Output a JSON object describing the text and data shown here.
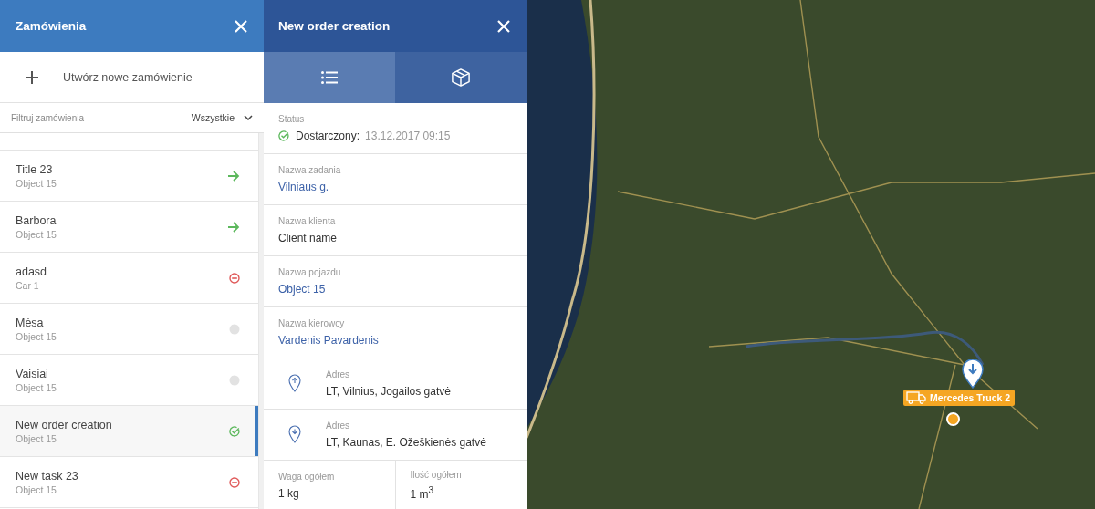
{
  "orders_panel": {
    "title": "Zamówienia",
    "create_label": "Utwórz nowe zamówienie",
    "filter": {
      "placeholder": "Filtruj zamówienia",
      "value": "Wszystkie"
    },
    "orders": [
      {
        "title": "Title 23",
        "subtitle": "Object 15",
        "kind": "arrow",
        "selected": false
      },
      {
        "title": "Barbora",
        "subtitle": "Object 15",
        "kind": "arrow",
        "selected": false
      },
      {
        "title": "adasd",
        "subtitle": "Car 1",
        "kind": "cancelled",
        "selected": false
      },
      {
        "title": "Mėsa",
        "subtitle": "Object 15",
        "kind": "idle",
        "selected": false
      },
      {
        "title": "Vaisiai",
        "subtitle": "Object 15",
        "kind": "idle",
        "selected": false
      },
      {
        "title": "New order creation",
        "subtitle": "Object 15",
        "kind": "done",
        "selected": true
      },
      {
        "title": "New task 23",
        "subtitle": "Object 15",
        "kind": "cancelled",
        "selected": false
      }
    ]
  },
  "detail_panel": {
    "title": "New order creation",
    "tabs": [
      {
        "kind": "list",
        "selected": true
      },
      {
        "kind": "box",
        "selected": false
      }
    ],
    "status": {
      "label": "Status",
      "value": "Dostarczony:",
      "time": "13.12.2017 09:15"
    },
    "fields": [
      {
        "label": "Nazwa zadania",
        "value": "Vilniaus g.",
        "link": true
      },
      {
        "label": "Nazwa klienta",
        "value": "Client name",
        "link": false
      },
      {
        "label": "Nazwa pojazdu",
        "value": "Object 15",
        "link": true
      },
      {
        "label": "Nazwa kierowcy",
        "value": "Vardenis Pavardenis",
        "link": true
      }
    ],
    "addresses": [
      {
        "kind": "pickup",
        "label": "Adres",
        "value": "LT, Vilnius, Jogailos gatvė"
      },
      {
        "kind": "dropoff",
        "label": "Adres",
        "value": "LT, Kaunas, E. Ožeškienės gatvė"
      }
    ],
    "totals": [
      {
        "label": "Waga ogółem",
        "value": "1 kg"
      },
      {
        "label": "Ilość ogółem",
        "value": "1 m$^{3}$"
      }
    ]
  },
  "map": {
    "vehicle_label": "Mercedes Truck 2"
  }
}
